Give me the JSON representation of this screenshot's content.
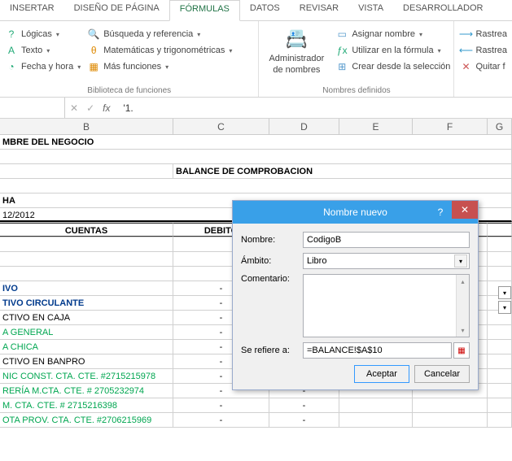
{
  "tabs": {
    "insertar": "INSERTAR",
    "diseno": "DISEÑO DE PÁGINA",
    "formulas": "FÓRMULAS",
    "datos": "DATOS",
    "revisar": "REVISAR",
    "vista": "VISTA",
    "desarrollador": "DESARROLLADOR"
  },
  "ribbon": {
    "logicas": "Lógicas",
    "texto": "Texto",
    "fecha": "Fecha y hora",
    "busqueda": "Búsqueda y referencia",
    "mate": "Matemáticas y trigonométricas",
    "mas": "Más funciones",
    "biblio_label": "Biblioteca de funciones",
    "admin_top": "Administrador",
    "admin_bot": "de nombres",
    "asignar": "Asignar nombre",
    "utilizar": "Utilizar en la fórmula",
    "crear": "Crear desde la selección",
    "nombres_label": "Nombres definidos",
    "rastrea1": "Rastrea",
    "rastrea2": "Rastrea",
    "quitar": "Quitar f"
  },
  "fbar": {
    "fx": "fx",
    "formula": "'1."
  },
  "cols": {
    "b": "B",
    "c": "C",
    "d": "D",
    "e": "E",
    "f": "F",
    "g": "G"
  },
  "sheet": {
    "nombre_negocio": "MBRE DEL NEGOCIO",
    "balance_title": "BALANCE DE COMPROBACION",
    "ha": "HA",
    "fecha": "12/2012",
    "cuentas": "CUENTAS",
    "debito": "DEBITO",
    "rows": [
      {
        "txt": "IVO",
        "cls": "navy"
      },
      {
        "txt": "TIVO CIRCULANTE",
        "cls": "navy"
      },
      {
        "txt": "CTIVO EN CAJA",
        "cls": ""
      },
      {
        "txt": "A GENERAL",
        "cls": "green"
      },
      {
        "txt": "A CHICA",
        "cls": "green"
      },
      {
        "txt": "CTIVO EN BANPRO",
        "cls": ""
      },
      {
        "txt": "NIC CONST. CTA. CTE. #2715215978",
        "cls": "green"
      },
      {
        "txt": "RERÍA M.CTA. CTE. # 2705232974",
        "cls": "green"
      },
      {
        "txt": "M. CTA. CTE. # 2715216398",
        "cls": "green"
      },
      {
        "txt": "OTA PROV. CTA. CTE. #2706215969",
        "cls": "green"
      }
    ],
    "dash": "-"
  },
  "dialog": {
    "title": "Nombre nuevo",
    "help": "?",
    "close": "✕",
    "nombre_lbl": "Nombre:",
    "nombre_val": "CodigoB",
    "ambito_lbl": "Ámbito:",
    "ambito_val": "Libro",
    "comentario_lbl": "Comentario:",
    "refiere_lbl": "Se refiere a:",
    "refiere_val": "=BALANCE!$A$10",
    "aceptar": "Aceptar",
    "cancelar": "Cancelar"
  }
}
